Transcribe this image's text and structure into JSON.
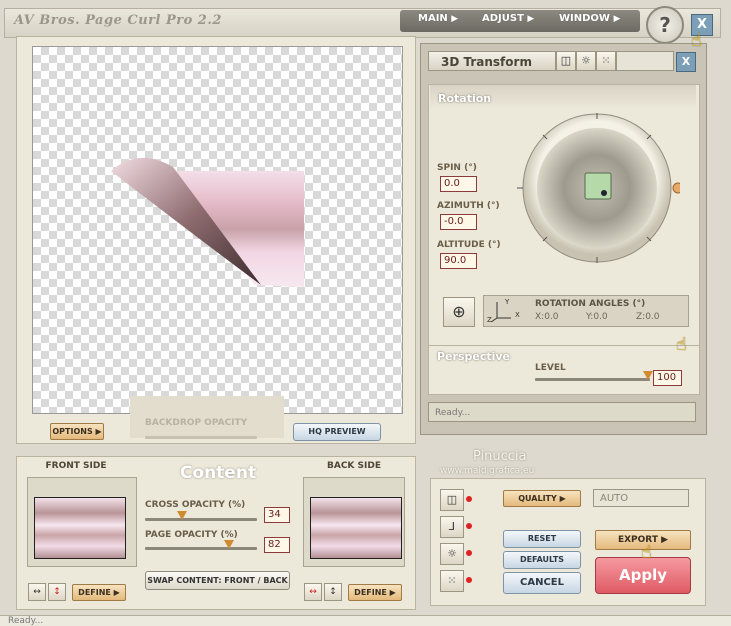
{
  "app": {
    "title": "AV Bros. Page Curl Pro 2.2",
    "menu": [
      {
        "label": "MAIN"
      },
      {
        "label": "ADJUST"
      },
      {
        "label": "WINDOW"
      }
    ],
    "help_label": "?",
    "close_label": "X"
  },
  "canvas": {
    "options_label": "OPTIONS",
    "backdrop_label": "BACKDROP OPACITY",
    "hq_preview_label": "HQ PREVIEW"
  },
  "transform": {
    "title": "3D Transform",
    "close_label": "X",
    "rotation_header": "Rotation",
    "spin_label": "SPIN (°)",
    "spin_value": "0.0",
    "azimuth_label": "AZIMUTH (°)",
    "azimuth_value": "-0.0",
    "altitude_label": "ALTITUDE (°)",
    "altitude_value": "90.0",
    "angles_title": "ROTATION ANGLES (°)",
    "angle_x": "X:0.0",
    "angle_y": "Y:0.0",
    "angle_z": "Z:0.0",
    "axis_x": "X",
    "axis_y": "Y",
    "axis_z": "Z",
    "perspective_header": "Perspective",
    "level_label": "LEVEL",
    "level_value": "100",
    "status": "Ready..."
  },
  "content": {
    "front_label": "FRONT SIDE",
    "title": "Content",
    "back_label": "BACK SIDE",
    "cross_label": "CROSS OPACITY (%)",
    "cross_value": "34",
    "page_label": "PAGE OPACITY (%)",
    "page_value": "82",
    "swap_label": "SWAP CONTENT: FRONT / BACK",
    "define_front": "DEFINE",
    "define_back": "DEFINE"
  },
  "actions": {
    "quality_label": "QUALITY",
    "quality_value": "AUTO",
    "reset_label": "RESET",
    "defaults_label": "DEFAULTS",
    "cancel_label": "CANCEL",
    "export_label": "EXPORT",
    "apply_label": "Apply"
  },
  "watermark": {
    "line1": "Pinuccia",
    "line2": "www.maidigrafica.eu"
  },
  "status_bar": {
    "text": "Ready..."
  },
  "colors": {
    "accent": "#d08a30",
    "apply": "#e96a72",
    "value_border": "#8c3a3a"
  }
}
